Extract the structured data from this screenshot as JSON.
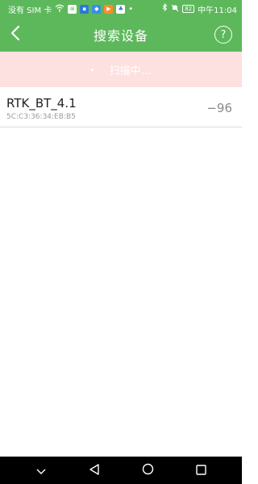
{
  "status_bar": {
    "carrier": "没有 SIM 卡",
    "battery": "82",
    "time": "中午11:04",
    "icons": [
      "wifi-icon",
      "notification-app-icons",
      "bluetooth-icon",
      "mute-icon",
      "battery-icon"
    ]
  },
  "app_bar": {
    "title": "搜索设备",
    "back_icon": "chevron-left-icon",
    "help_label": "?"
  },
  "scan": {
    "status": "扫描中..."
  },
  "devices": [
    {
      "name": "RTK_BT_4.1",
      "mac": "5C:C3:36:34:EB:B5",
      "rssi": "−96"
    }
  ],
  "colors": {
    "primary_green": "#5db85c",
    "scan_banner_bg": "#fde0e0",
    "nav_bar_bg": "#000000"
  },
  "nav_bar": {
    "buttons": [
      "collapse-icon",
      "back-triangle-icon",
      "home-circle-icon",
      "recents-square-icon"
    ]
  }
}
